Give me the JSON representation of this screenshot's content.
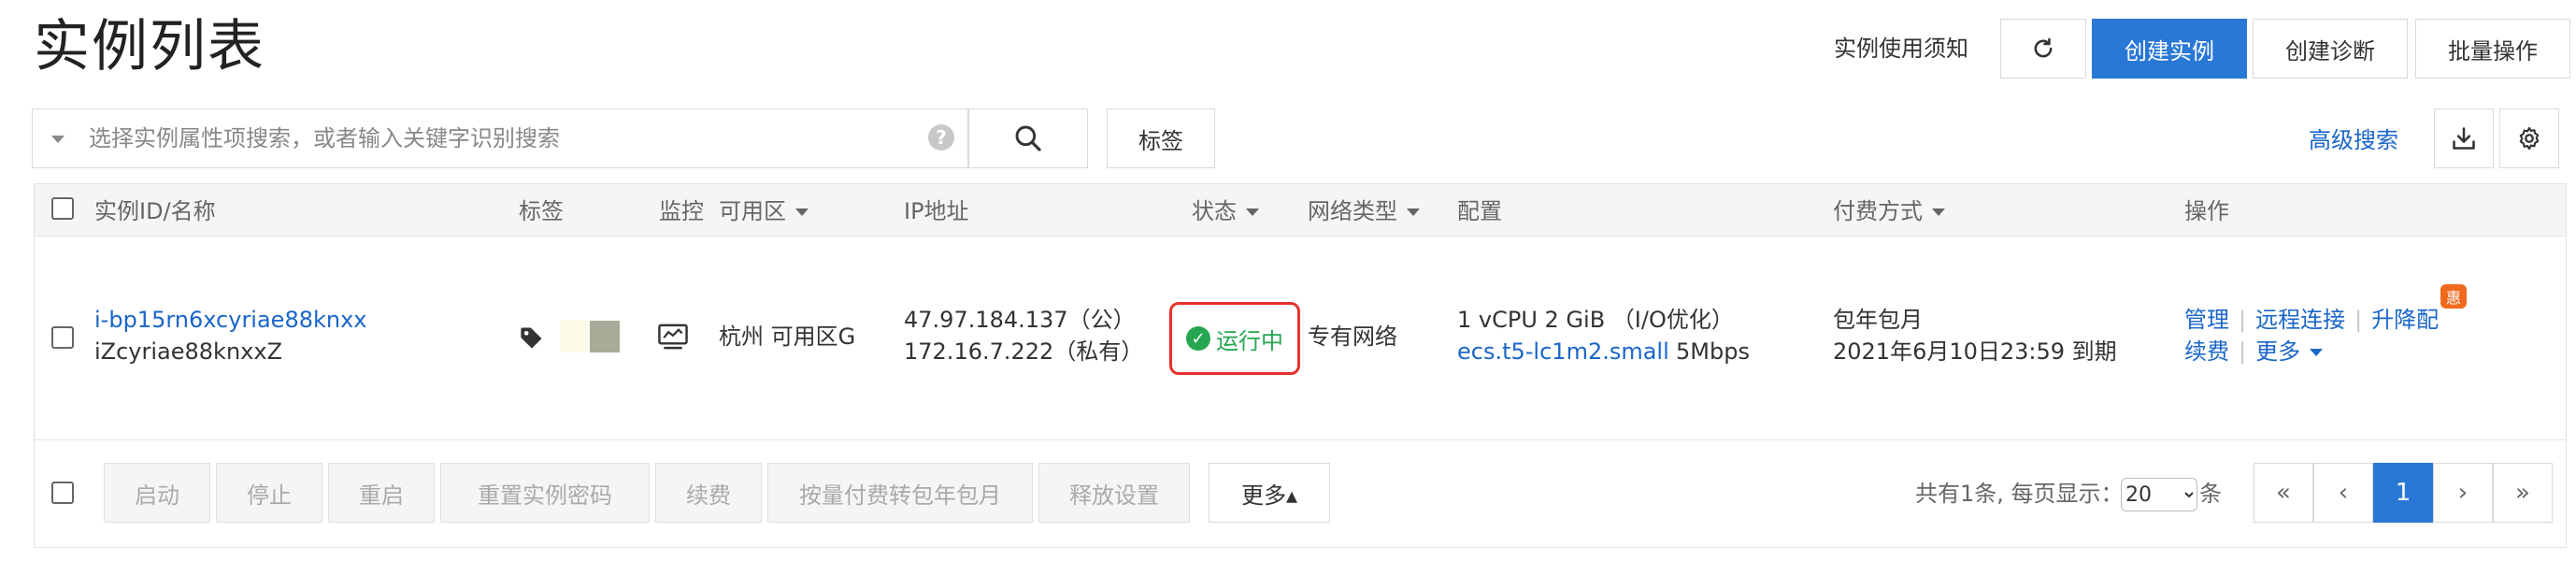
{
  "header": {
    "title": "实例列表",
    "notice_link": "实例使用须知",
    "create_label": "创建实例",
    "diagnose_label": "创建诊断",
    "batch_label": "批量操作"
  },
  "search": {
    "placeholder": "选择实例属性项搜索，或者输入关键字识别搜索",
    "help_glyph": "?",
    "tag_label": "标签",
    "advanced_label": "高级搜索"
  },
  "table": {
    "columns": {
      "id_name": "实例ID/名称",
      "tags": "标签",
      "monitor": "监控",
      "zone": "可用区",
      "ip": "IP地址",
      "status": "状态",
      "network": "网络类型",
      "config": "配置",
      "billing": "付费方式",
      "actions": "操作"
    },
    "rows": [
      {
        "instance_id": "i-bp15rn6xcyriae88knxx",
        "name": "iZcyriae88knxxZ",
        "zone": "杭州 可用区G",
        "public_ip": "47.97.184.137（公）",
        "private_ip": "172.16.7.222（私有）",
        "status": "运行中",
        "network": "专有网络",
        "config_spec": "1 vCPU 2 GiB （I/O优化）",
        "instance_type": "ecs.t5-lc1m2.small",
        "bandwidth": "5Mbps",
        "billing_type": "包年包月",
        "expire": "2021年6月10日23:59 到期",
        "actions": {
          "manage": "管理",
          "remote": "远程连接",
          "upgrade": "升降配",
          "renew": "续费",
          "more": "更多",
          "separator": "|",
          "badge": "惠"
        }
      }
    ]
  },
  "footer": {
    "buttons": [
      "启动",
      "停止",
      "重启",
      "重置实例密码",
      "续费",
      "按量付费转包年包月",
      "释放设置"
    ],
    "more_label": "更多▴",
    "total_text": "共有1条, 每页显示：",
    "page_size": "20",
    "unit": "条",
    "pagination": {
      "first": "«",
      "prev": "‹",
      "current": "1",
      "next": "›",
      "last": "»"
    }
  },
  "colors": {
    "primary": "#2a78d6",
    "link": "#1a66c9",
    "running": "#26a650",
    "highlight_border": "#e4332c",
    "badge": "#f06a1d"
  },
  "icons": [
    "refresh-icon",
    "caret-down-icon",
    "help-icon",
    "search-icon",
    "download-icon",
    "settings-icon",
    "tag-icon",
    "monitor-icon",
    "check-circle-icon"
  ]
}
